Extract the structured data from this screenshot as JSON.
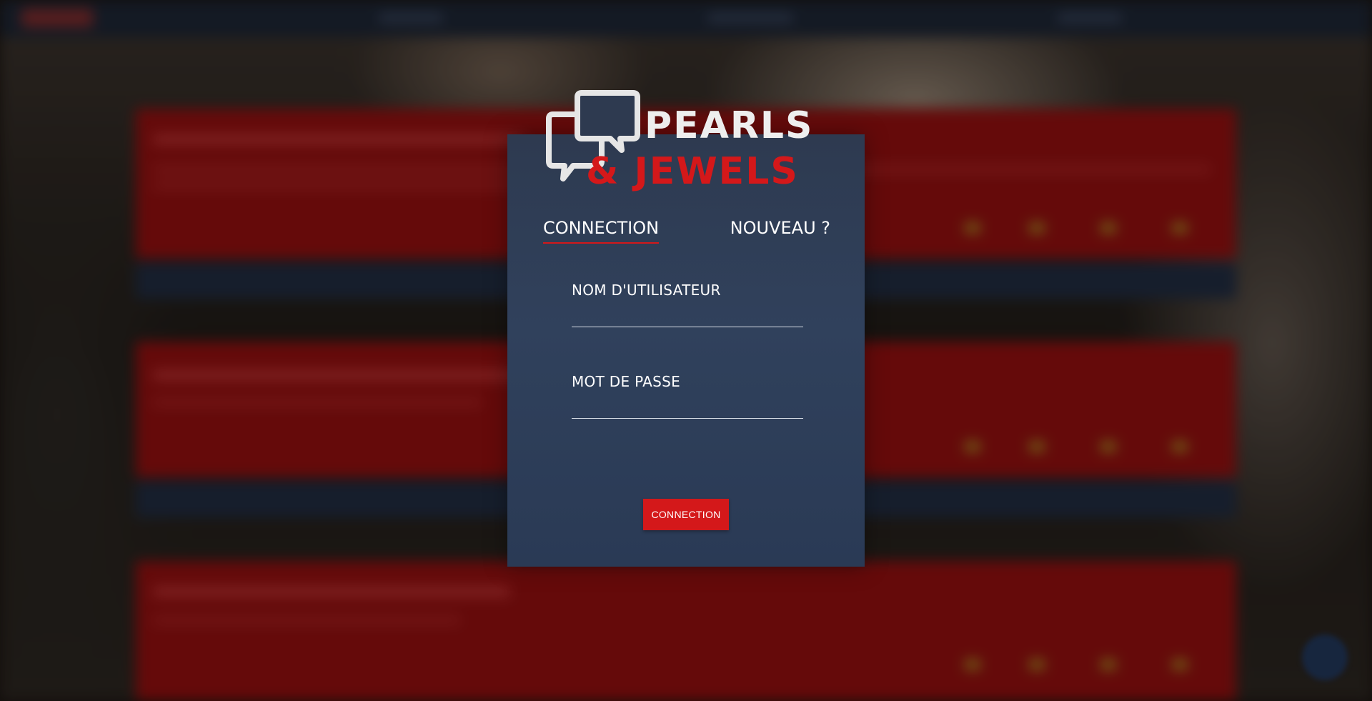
{
  "brand": {
    "line1": "PEARLS",
    "line2": "& JEWELS"
  },
  "tabs": {
    "login": "CONNECTION",
    "new": "NOUVEAU ?"
  },
  "form": {
    "username_label": "NOM D'UTILISATEUR",
    "username_value": "",
    "password_label": "MOT DE PASSE",
    "password_value": "",
    "submit_label": "CONNECTION"
  },
  "colors": {
    "accent": "#d4181a",
    "panel": "#2e3a50",
    "text": "#ffffff"
  },
  "icons": {
    "logo": "speech-bubbles-icon"
  }
}
